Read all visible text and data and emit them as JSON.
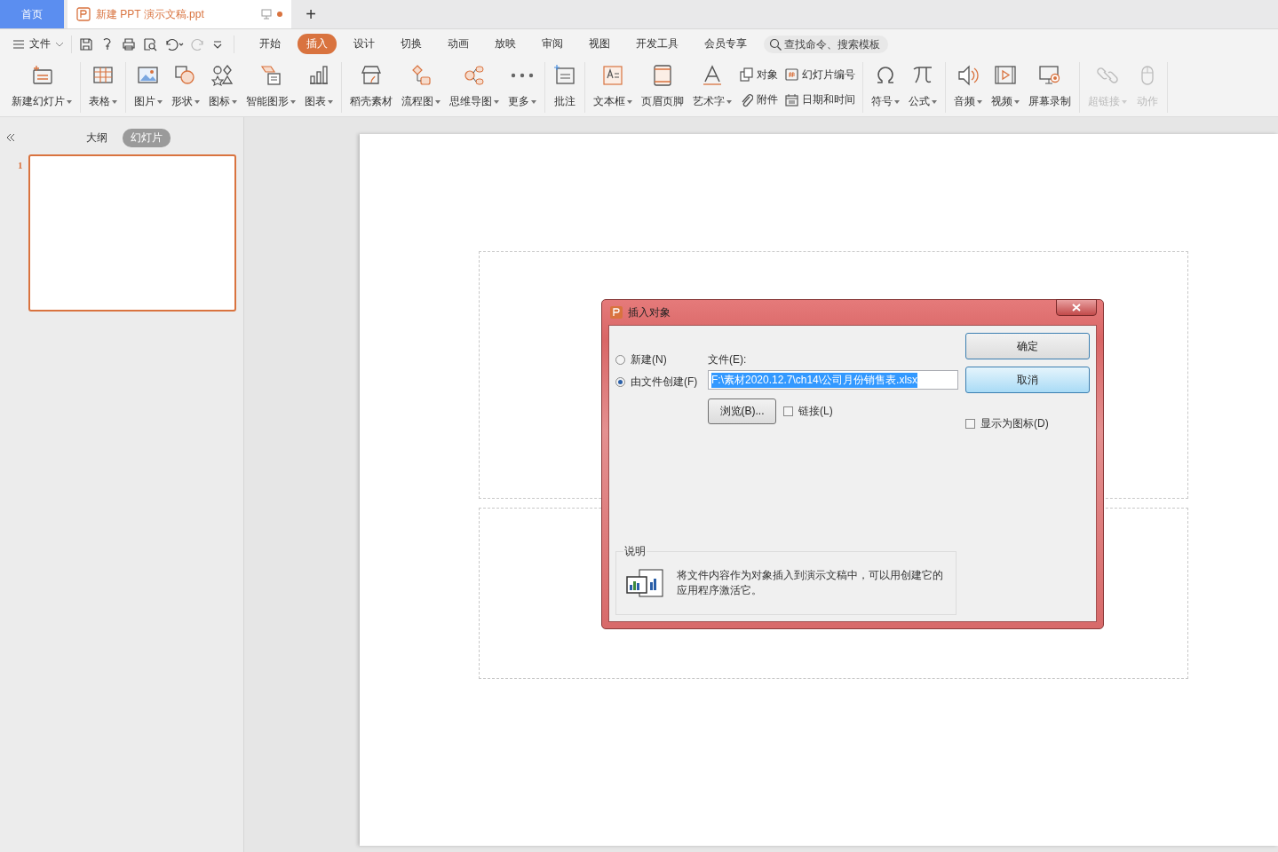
{
  "tabbar": {
    "home": "首页",
    "document": {
      "title": "新建 PPT 演示文稿.ppt",
      "selected": true,
      "unsaved": true
    },
    "new_tab": "+"
  },
  "menubar": {
    "file_menu": "文件",
    "tabs": [
      {
        "label": "开始",
        "selected": false
      },
      {
        "label": "插入",
        "selected": true
      },
      {
        "label": "设计",
        "selected": false
      },
      {
        "label": "切换",
        "selected": false
      },
      {
        "label": "动画",
        "selected": false
      },
      {
        "label": "放映",
        "selected": false
      },
      {
        "label": "审阅",
        "selected": false
      },
      {
        "label": "视图",
        "selected": false
      },
      {
        "label": "开发工具",
        "selected": false
      },
      {
        "label": "会员专享",
        "selected": false
      }
    ],
    "search": {
      "placeholder": "查找命令、搜索模板"
    }
  },
  "ribbon": {
    "groups": [
      [
        {
          "kind": "big",
          "label": "新建幻灯片",
          "dropdown": true,
          "disabled": false
        }
      ],
      [
        {
          "kind": "big",
          "label": "表格",
          "dropdown": true,
          "disabled": false
        }
      ],
      [
        {
          "kind": "big",
          "label": "图片",
          "dropdown": true,
          "disabled": false
        },
        {
          "kind": "big",
          "label": "形状",
          "dropdown": true,
          "disabled": false
        },
        {
          "kind": "big",
          "label": "图标",
          "dropdown": true,
          "disabled": false
        },
        {
          "kind": "big",
          "label": "智能图形",
          "dropdown": true,
          "disabled": false
        },
        {
          "kind": "big",
          "label": "图表",
          "dropdown": true,
          "disabled": false
        }
      ],
      [
        {
          "kind": "big",
          "label": "稻壳素材",
          "dropdown": false,
          "disabled": false
        },
        {
          "kind": "big",
          "label": "流程图",
          "dropdown": true,
          "disabled": false
        },
        {
          "kind": "big",
          "label": "思维导图",
          "dropdown": true,
          "disabled": false
        },
        {
          "kind": "big",
          "label": "更多",
          "dropdown": true,
          "disabled": false
        }
      ],
      [
        {
          "kind": "big",
          "label": "批注",
          "dropdown": false,
          "disabled": false
        }
      ],
      [
        {
          "kind": "big",
          "label": "文本框",
          "dropdown": true,
          "disabled": false
        },
        {
          "kind": "big",
          "label": "页眉页脚",
          "dropdown": false,
          "disabled": false
        },
        {
          "kind": "big",
          "label": "艺术字",
          "dropdown": true,
          "disabled": false
        },
        {
          "kind": "pair",
          "items": [
            "对象",
            "附件"
          ]
        },
        {
          "kind": "pair",
          "items": [
            "幻灯片编号",
            "日期和时间"
          ]
        }
      ],
      [
        {
          "kind": "big",
          "label": "符号",
          "dropdown": true,
          "disabled": false
        },
        {
          "kind": "big",
          "label": "公式",
          "dropdown": true,
          "disabled": false
        }
      ],
      [
        {
          "kind": "big",
          "label": "音频",
          "dropdown": true,
          "disabled": false
        },
        {
          "kind": "big",
          "label": "视频",
          "dropdown": true,
          "disabled": false
        },
        {
          "kind": "big",
          "label": "屏幕录制",
          "dropdown": false,
          "disabled": false
        }
      ],
      [
        {
          "kind": "big",
          "label": "超链接",
          "dropdown": true,
          "disabled": true
        },
        {
          "kind": "big",
          "label": "动作",
          "dropdown": false,
          "disabled": true
        }
      ]
    ]
  },
  "sidebar": {
    "tabs": [
      {
        "label": "大纲",
        "selected": false
      },
      {
        "label": "幻灯片",
        "selected": true
      }
    ],
    "slides": [
      {
        "number": "1",
        "selected": true
      }
    ]
  },
  "dialog": {
    "title": "插入对象",
    "options": [
      {
        "label": "新建(N)",
        "selected": false
      },
      {
        "label": "由文件创建(F)",
        "selected": true
      }
    ],
    "file_label": "文件(E):",
    "file_value": "F:\\素材2020.12.7\\ch14\\公司月份销售表.xlsx",
    "file_value_selected": true,
    "browse_button": "浏览(B)...",
    "link_checkbox": {
      "label": "链接(L)",
      "checked": false
    },
    "buttons": [
      {
        "label": "确定",
        "highlighted": false
      },
      {
        "label": "取消",
        "highlighted": true
      }
    ],
    "icon_checkbox": {
      "label": "显示为图标(D)",
      "checked": false
    },
    "description": {
      "title": "说明",
      "text": "将文件内容作为对象插入到演示文稿中，可以用创建它的应用程序激活它。"
    }
  }
}
